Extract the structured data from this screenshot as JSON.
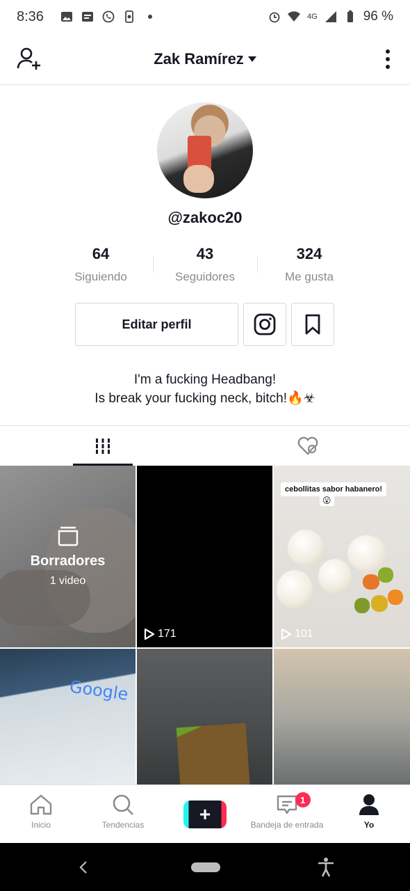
{
  "status_bar": {
    "time": "8:36",
    "network": "4G",
    "battery": "96 %"
  },
  "header": {
    "title": "Zak Ramírez"
  },
  "profile": {
    "username": "@zakoc20",
    "stats": [
      {
        "value": "64",
        "label": "Siguiendo"
      },
      {
        "value": "43",
        "label": "Seguidores"
      },
      {
        "value": "324",
        "label": "Me gusta"
      }
    ],
    "edit_label": "Editar perfil",
    "bio_line1": "I'm a fucking Headbang!",
    "bio_line2": "Is break your fucking neck, bitch!🔥☣"
  },
  "grid": {
    "drafts_title": "Borradores",
    "drafts_count": "1 video",
    "video2_views": "171",
    "video3_views": "101",
    "video3_caption": "cebollitas sabor habanero!",
    "video3_emoji": "😮",
    "video4_text": "Google"
  },
  "bottom_nav": {
    "home": "Inicio",
    "discover": "Tendencias",
    "create": "+",
    "inbox": "Bandeja de entrada",
    "inbox_badge": "1",
    "me": "Yo"
  },
  "colors": {
    "accent": "#fe2c55",
    "cyan": "#25f4ee",
    "text": "#161823",
    "muted": "#8a8b91"
  }
}
